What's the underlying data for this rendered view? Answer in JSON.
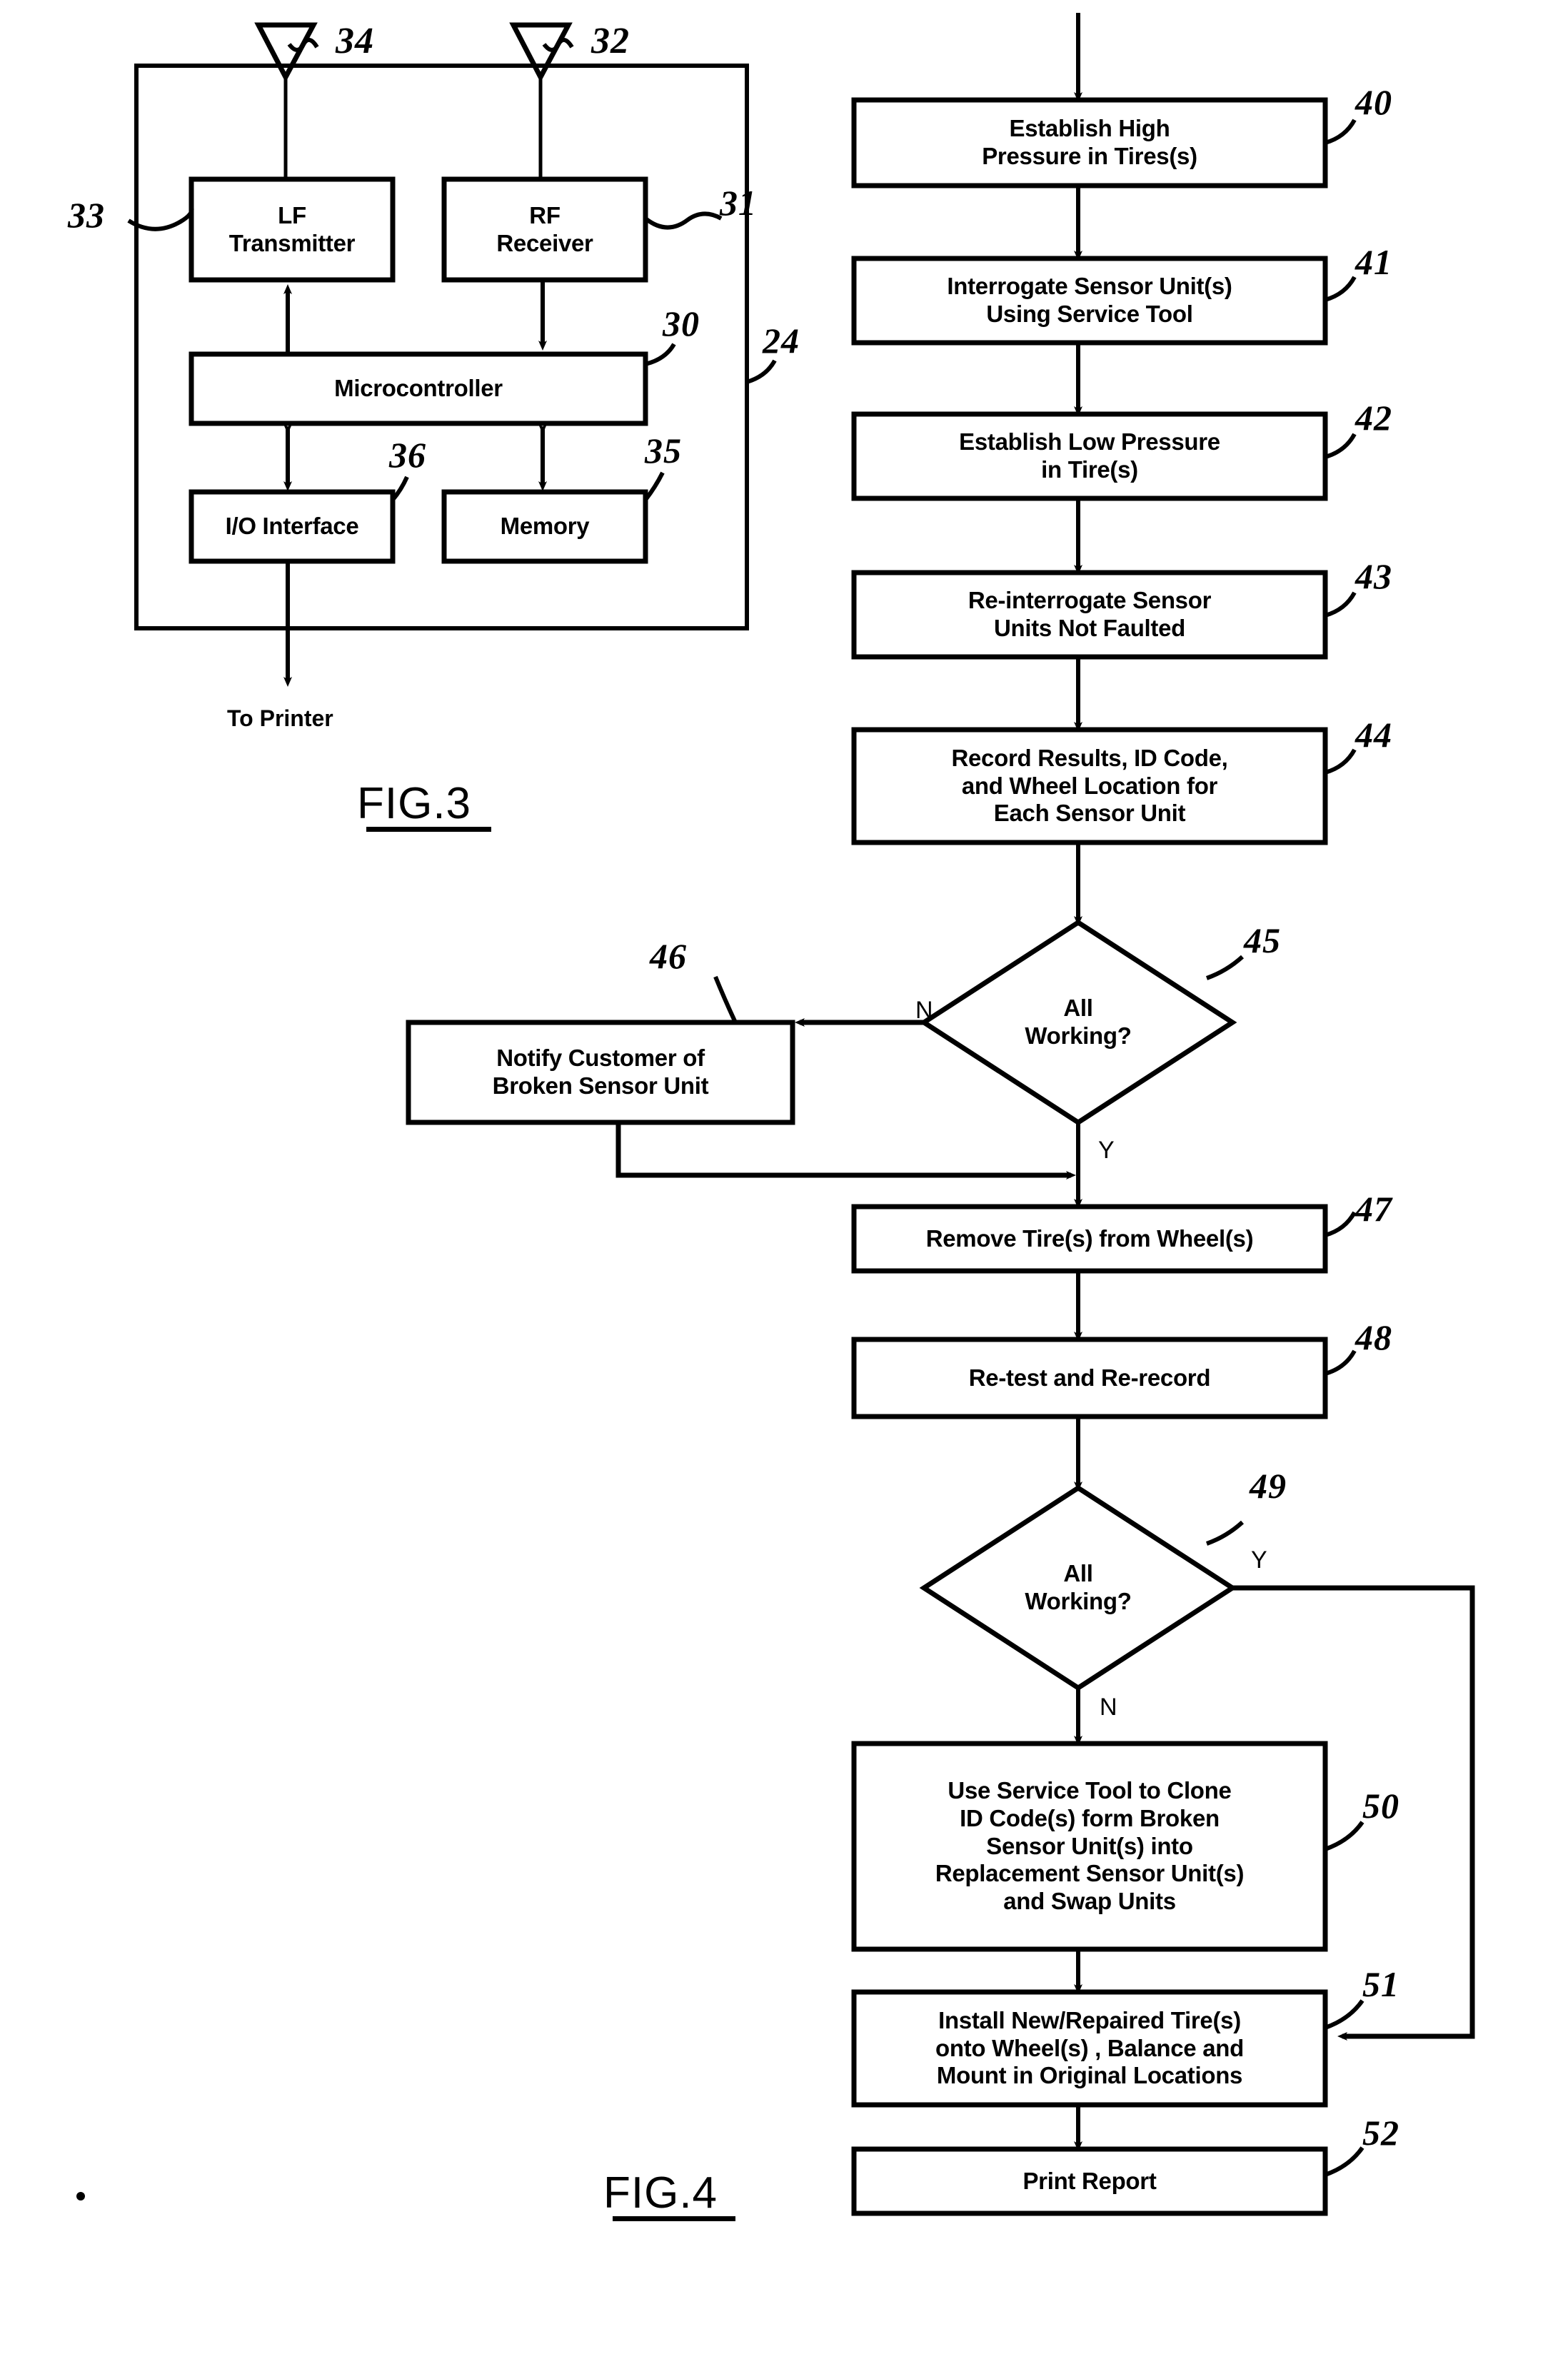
{
  "figures": {
    "fig3": {
      "caption": "FIG.3",
      "blocks": [
        {
          "id": "lf-transmitter",
          "label": "LF\nTransmitter",
          "ref": "33"
        },
        {
          "id": "rf-receiver",
          "label": "RF\nReceiver",
          "ref": "31"
        },
        {
          "id": "microcontroller",
          "label": "Microcontroller",
          "ref": "30"
        },
        {
          "id": "io-interface",
          "label": "I/O Interface",
          "ref": "36"
        },
        {
          "id": "memory",
          "label": "Memory",
          "ref": "35"
        }
      ],
      "antennas": [
        {
          "id": "lf-antenna",
          "ref": "34"
        },
        {
          "id": "rf-antenna",
          "ref": "32"
        }
      ],
      "enclosure_ref": "24",
      "output_label": "To Printer"
    },
    "fig4": {
      "caption": "FIG.4",
      "steps": [
        {
          "id": "step-40",
          "ref": "40",
          "label": "Establish High\nPressure in Tires(s)"
        },
        {
          "id": "step-41",
          "ref": "41",
          "label": "Interrogate Sensor Unit(s)\nUsing Service Tool"
        },
        {
          "id": "step-42",
          "ref": "42",
          "label": "Establish Low Pressure\nin Tire(s)"
        },
        {
          "id": "step-43",
          "ref": "43",
          "label": "Re-interrogate Sensor\nUnits Not Faulted"
        },
        {
          "id": "step-44",
          "ref": "44",
          "label": "Record Results, ID Code,\nand Wheel Location for\nEach Sensor Unit"
        },
        {
          "id": "decision-45",
          "ref": "45",
          "label": "All\nWorking?"
        },
        {
          "id": "step-46",
          "ref": "46",
          "label": "Notify Customer of\nBroken  Sensor Unit"
        },
        {
          "id": "step-47",
          "ref": "47",
          "label": "Remove Tire(s) from Wheel(s)"
        },
        {
          "id": "step-48",
          "ref": "48",
          "label": "Re-test and Re-record"
        },
        {
          "id": "decision-49",
          "ref": "49",
          "label": "All\nWorking?"
        },
        {
          "id": "step-50",
          "ref": "50",
          "label": "Use Service Tool to Clone\nID Code(s) form Broken\nSensor Unit(s) into\nReplacement Sensor Unit(s)\nand Swap Units"
        },
        {
          "id": "step-51",
          "ref": "51",
          "label": "Install New/Repaired Tire(s)\nonto Wheel(s) , Balance and\nMount in Original Locations"
        },
        {
          "id": "step-52",
          "ref": "52",
          "label": "Print Report"
        }
      ],
      "branch_labels": {
        "d45_no": "N",
        "d45_yes": "Y",
        "d49_yes": "Y",
        "d49_no": "N"
      }
    }
  },
  "colors": {
    "ink": "#000000",
    "paper": "#ffffff"
  }
}
